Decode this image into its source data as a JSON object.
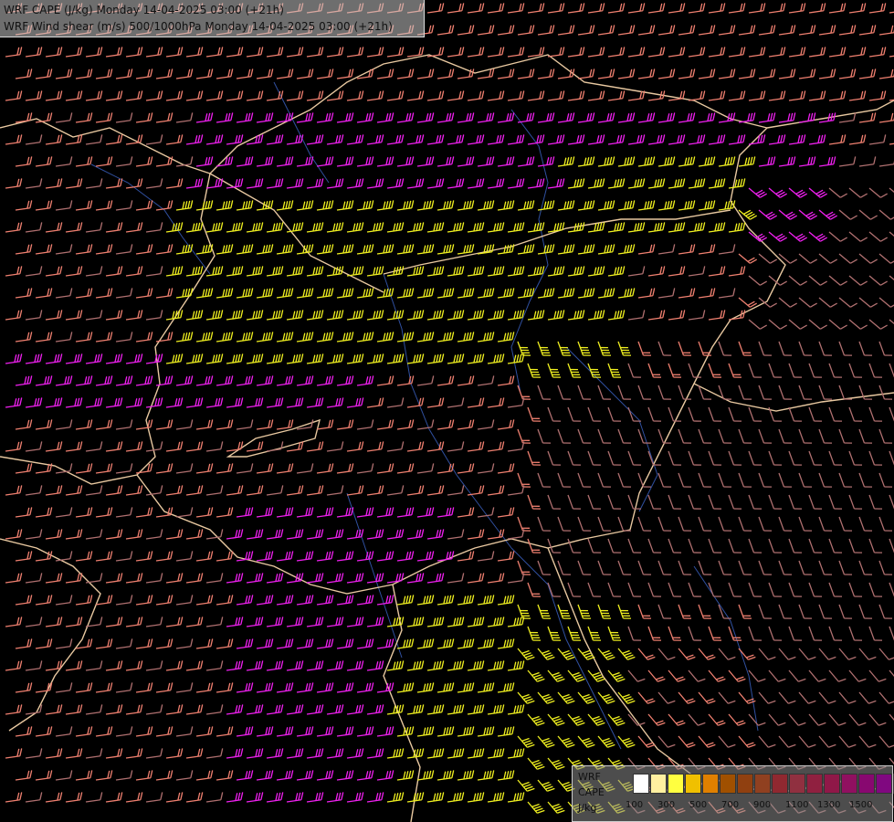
{
  "header": {
    "line1": "WRF CAPE (J/kg) Monday 14-04-2025 03:00 (+21h)",
    "line2": "WRF Wind shear (m/s) 500/1000hPa Monday 14-04-2025 03:00 (+21h)"
  },
  "legend": {
    "label_model": "WRF",
    "label_field": "CAPE",
    "label_unit": "J/kg",
    "colors": [
      "#ffffff",
      "#fff0a0",
      "#ffff40",
      "#f0c000",
      "#e08000",
      "#a05000",
      "#904010",
      "#904020",
      "#902830",
      "#903040",
      "#902040",
      "#901848",
      "#901060",
      "#880870",
      "#800880",
      "#800060"
    ],
    "ticks": [
      "100",
      "300",
      "500",
      "700",
      "900",
      "1100",
      "1300",
      "1500"
    ]
  },
  "barbs": {
    "colors": {
      "low": "#b07070",
      "mid": "#f08070",
      "high": "#f020f0",
      "extreme": "#f0f020"
    }
  },
  "map": {
    "border_color": "#e8c8a0",
    "river_color": "#3050a0",
    "background": "#000000"
  }
}
